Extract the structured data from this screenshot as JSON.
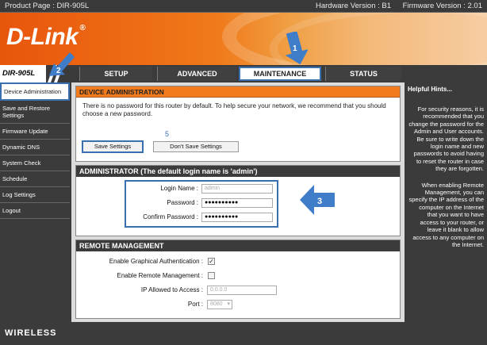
{
  "topbar": {
    "product": "Product Page : DIR-905L",
    "hardware": "Hardware Version : B1",
    "firmware": "Firmware Version : 2.01"
  },
  "brand": {
    "logo": "D-Link",
    "model": "DIR-905L"
  },
  "tabs": [
    "SETUP",
    "ADVANCED",
    "MAINTENANCE",
    "STATUS"
  ],
  "sidebar": {
    "items": [
      "Device Administration",
      "Save and Restore Settings",
      "Firmware Update",
      "Dynamic DNS",
      "System Check",
      "Schedule",
      "Log Settings",
      "Logout"
    ]
  },
  "device_admin": {
    "title": "DEVICE ADMINISTRATION",
    "description": "There is no password for this router by default. To help secure your network, we recommend that you should choose a new password.",
    "save_label": "Save Settings",
    "dont_save_label": "Don't Save Settings"
  },
  "administrator": {
    "title": "ADMINISTRATOR (The default login name is 'admin')",
    "login_name_label": "Login Name :",
    "login_name_value": "admin",
    "password_label": "Password :",
    "password_value": "●●●●●●●●●●",
    "confirm_label": "Confirm Password :",
    "confirm_value": "●●●●●●●●●●"
  },
  "remote": {
    "title": "REMOTE MANAGEMENT",
    "graphical_label": "Enable Graphical Authentication :",
    "graphical_checked": true,
    "remote_label": "Enable Remote Management :",
    "remote_checked": false,
    "ip_label": "IP Allowed to Access :",
    "ip_value": "0.0.0.0",
    "port_label": "Port :",
    "port_value": "8080"
  },
  "hints": {
    "title": "Helpful Hints...",
    "p1": "For security reasons, it is recommended that you change the password for the Admin and User accounts. Be sure to write down the login name and new passwords to avoid having to reset the router in case they are forgotten.",
    "p2": "When enabling Remote Management, you can specify the IP address of the computer on the Internet that you want to have access to your router, or leave it blank to allow access to any computer on the Internet."
  },
  "footer": {
    "label": "WIRELESS"
  },
  "callouts": {
    "n1": "1",
    "n2": "2",
    "n3": "3",
    "n5": "5"
  },
  "colors": {
    "orange": "#f27b1d",
    "dark": "#3b3b3b",
    "highlight": "#3a6fb0"
  }
}
